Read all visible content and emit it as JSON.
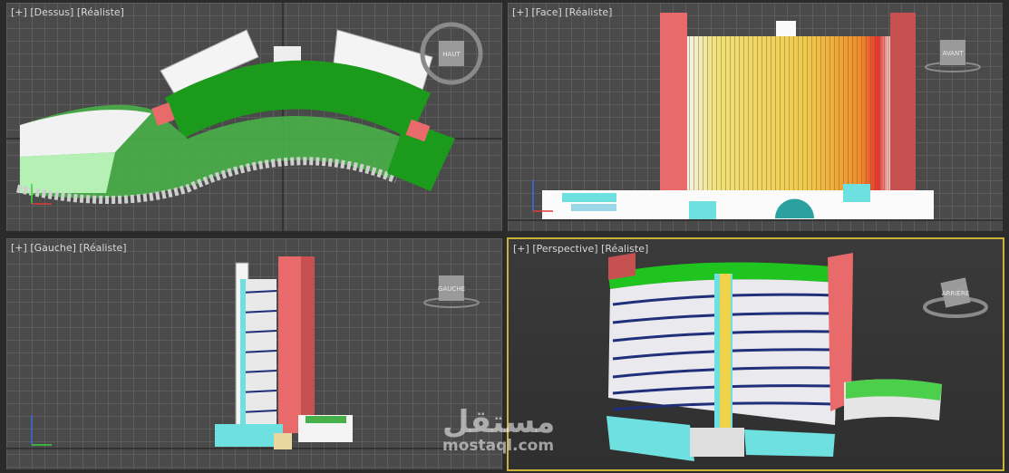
{
  "viewports": {
    "top": {
      "plus": "[+]",
      "name": "[Dessus]",
      "shading": "[Réaliste]",
      "cube_label": "HAUT"
    },
    "front": {
      "plus": "[+]",
      "name": "[Face]",
      "shading": "[Réaliste]",
      "cube_label": "AVANT"
    },
    "left": {
      "plus": "[+]",
      "name": "[Gauche]",
      "shading": "[Réaliste]",
      "cube_label": "GAUCHE"
    },
    "perspective": {
      "plus": "[+]",
      "name": "[Perspective]",
      "shading": "[Réaliste]",
      "cube_label": "ARRIÈRE"
    }
  },
  "watermark": {
    "arabic": "مستقل",
    "latin": "mostaql.com"
  },
  "colors": {
    "green": "#1c9a1c",
    "light_green": "#9be39b",
    "red_tower": "#e86a6a",
    "yellow": "#f1d24b",
    "cyan": "#6fe0e0",
    "navy": "#1f2f7a",
    "active_border": "#c9b23a"
  }
}
